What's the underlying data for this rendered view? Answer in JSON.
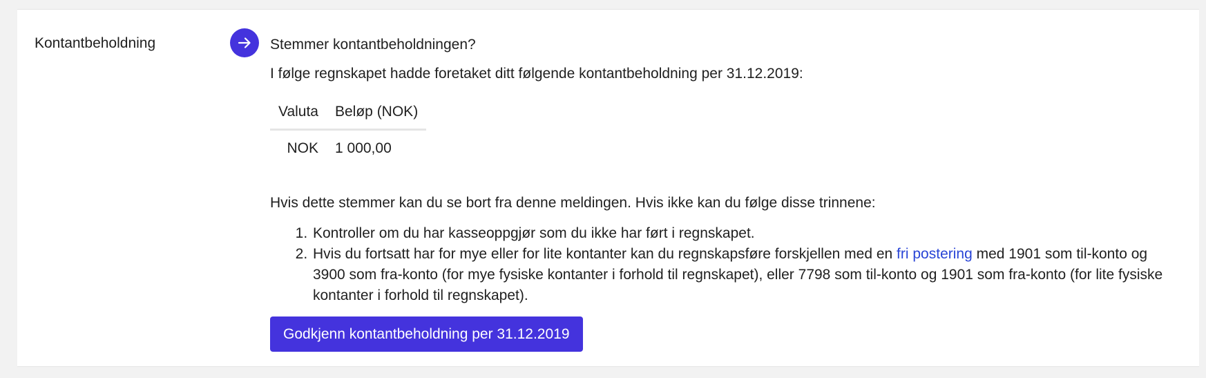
{
  "section": {
    "label": "Kontantbeholdning"
  },
  "step": {
    "icon": "arrow-right-icon",
    "question": "Stemmer kontantbeholdningen?",
    "intro": "I følge regnskapet hadde foretaket ditt følgende kontantbeholdning per 31.12.2019:"
  },
  "table": {
    "headers": [
      "Valuta",
      "Beløp (NOK)"
    ],
    "rows": [
      {
        "currency": "NOK",
        "amount": "1 000,00"
      }
    ]
  },
  "guidance": {
    "text": "Hvis dette stemmer kan du se bort fra denne meldingen. Hvis ikke kan du følge disse trinnene:",
    "step1": "Kontroller om du har kasseoppgjør som du ikke har ført i regnskapet.",
    "step2_before": "Hvis du fortsatt har for mye eller for lite kontanter kan du regnskapsføre forskjellen med en ",
    "step2_link": "fri postering",
    "step2_after": " med 1901 som til-konto og 3900 som fra-konto (for mye fysiske kontanter i forhold til regnskapet), eller 7798 som til-konto og 1901 som fra-konto (for lite fysiske kontanter i forhold til regnskapet)."
  },
  "actions": {
    "approve_label": "Godkjenn kontantbeholdning per 31.12.2019"
  },
  "colors": {
    "accent": "#4433dd",
    "link": "#2844d6",
    "background": "#f2f2f2"
  }
}
